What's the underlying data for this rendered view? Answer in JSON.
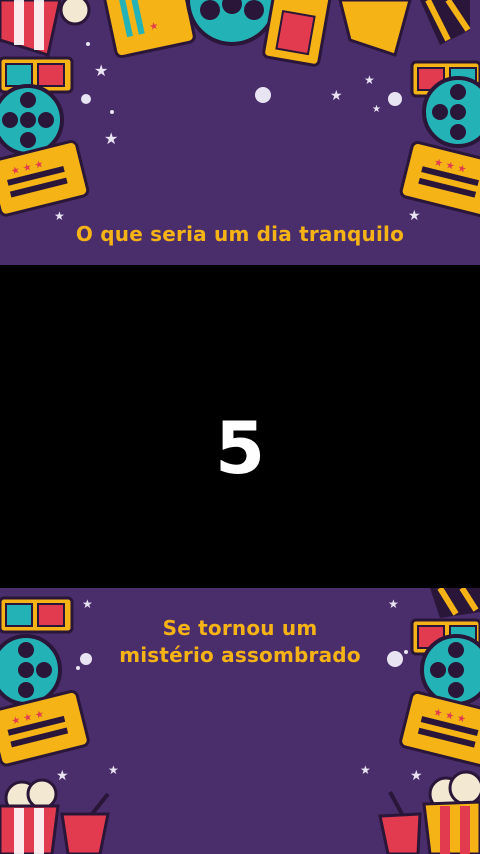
{
  "captions": {
    "top": "O que seria um dia tranquilo",
    "bottom_line1": "Se tornou um",
    "bottom_line2": "mistério assombrado"
  },
  "countdown": "5",
  "colors": {
    "panel_bg": "#4a2d6b",
    "caption": "#f5b316",
    "countdown": "#ffffff"
  },
  "decor_icons": [
    "ticket-icon",
    "film-reel-icon",
    "3d-glasses-icon",
    "clapperboard-icon",
    "popcorn-icon",
    "soda-cup-icon",
    "star-icon"
  ]
}
